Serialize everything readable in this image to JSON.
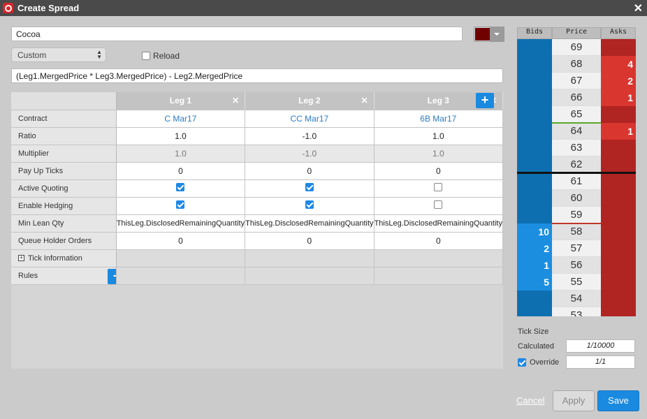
{
  "window": {
    "title": "Create Spread"
  },
  "spread": {
    "name": "Cocoa",
    "color": "#6e0000",
    "type_select": "Custom",
    "reload_label": "Reload",
    "reload_checked": false,
    "formula": "(Leg1.MergedPrice * Leg3.MergedPrice) - Leg2.MergedPrice"
  },
  "legs": {
    "headers": [
      "Leg 1",
      "Leg 2",
      "Leg 3"
    ],
    "rows": [
      {
        "label": "Contract",
        "values": [
          "C Mar17",
          "CC Mar17",
          "6B Mar17"
        ]
      },
      {
        "label": "Ratio",
        "values": [
          "1.0",
          "-1.0",
          "1.0"
        ]
      },
      {
        "label": "Multiplier",
        "values": [
          "1.0",
          "-1.0",
          "1.0"
        ]
      },
      {
        "label": "Pay Up Ticks",
        "values": [
          "0",
          "0",
          "0"
        ]
      },
      {
        "label": "Active Quoting",
        "checked": [
          true,
          true,
          false
        ]
      },
      {
        "label": "Enable Hedging",
        "checked": [
          true,
          true,
          false
        ]
      },
      {
        "label": "Min Lean Qty",
        "values": [
          "ThisLeg.DisclosedRemainingQuantity",
          "ThisLeg.DisclosedRemainingQuantity",
          "ThisLeg.DisclosedRemainingQuantity"
        ]
      },
      {
        "label": "Queue Holder Orders",
        "values": [
          "0",
          "0",
          "0"
        ]
      },
      {
        "label": "Tick Information"
      },
      {
        "label": "Rules"
      }
    ]
  },
  "ladder": {
    "headers": {
      "bids": "Bids",
      "price": "Price",
      "asks": "Asks"
    },
    "rows": [
      {
        "price": "69",
        "bid": "",
        "ask": ""
      },
      {
        "price": "68",
        "bid": "",
        "ask": "4"
      },
      {
        "price": "67",
        "bid": "",
        "ask": "2"
      },
      {
        "price": "66",
        "bid": "",
        "ask": "1"
      },
      {
        "price": "65",
        "bid": "",
        "ask": ""
      },
      {
        "price": "64",
        "bid": "",
        "ask": "1"
      },
      {
        "price": "63",
        "bid": "",
        "ask": ""
      },
      {
        "price": "62",
        "bid": "",
        "ask": ""
      },
      {
        "price": "61",
        "bid": "",
        "ask": ""
      },
      {
        "price": "60",
        "bid": "",
        "ask": ""
      },
      {
        "price": "59",
        "bid": "",
        "ask": ""
      },
      {
        "price": "58",
        "bid": "10",
        "ask": ""
      },
      {
        "price": "57",
        "bid": "2",
        "ask": ""
      },
      {
        "price": "56",
        "bid": "1",
        "ask": ""
      },
      {
        "price": "55",
        "bid": "5",
        "ask": ""
      },
      {
        "price": "54",
        "bid": "",
        "ask": ""
      },
      {
        "price": "53",
        "bid": "",
        "ask": ""
      }
    ]
  },
  "tick_size": {
    "title": "Tick Size",
    "calculated_label": "Calculated",
    "calculated_value": "1/10000",
    "override_label": "Override",
    "override_checked": true,
    "override_value": "1/1"
  },
  "buttons": {
    "cancel": "Cancel",
    "apply": "Apply",
    "save": "Save"
  },
  "colors": {
    "accent": "#1a8ae0",
    "bid": "#0e6fb0",
    "ask": "#b02422",
    "titlebar": "#4a4a4a"
  }
}
